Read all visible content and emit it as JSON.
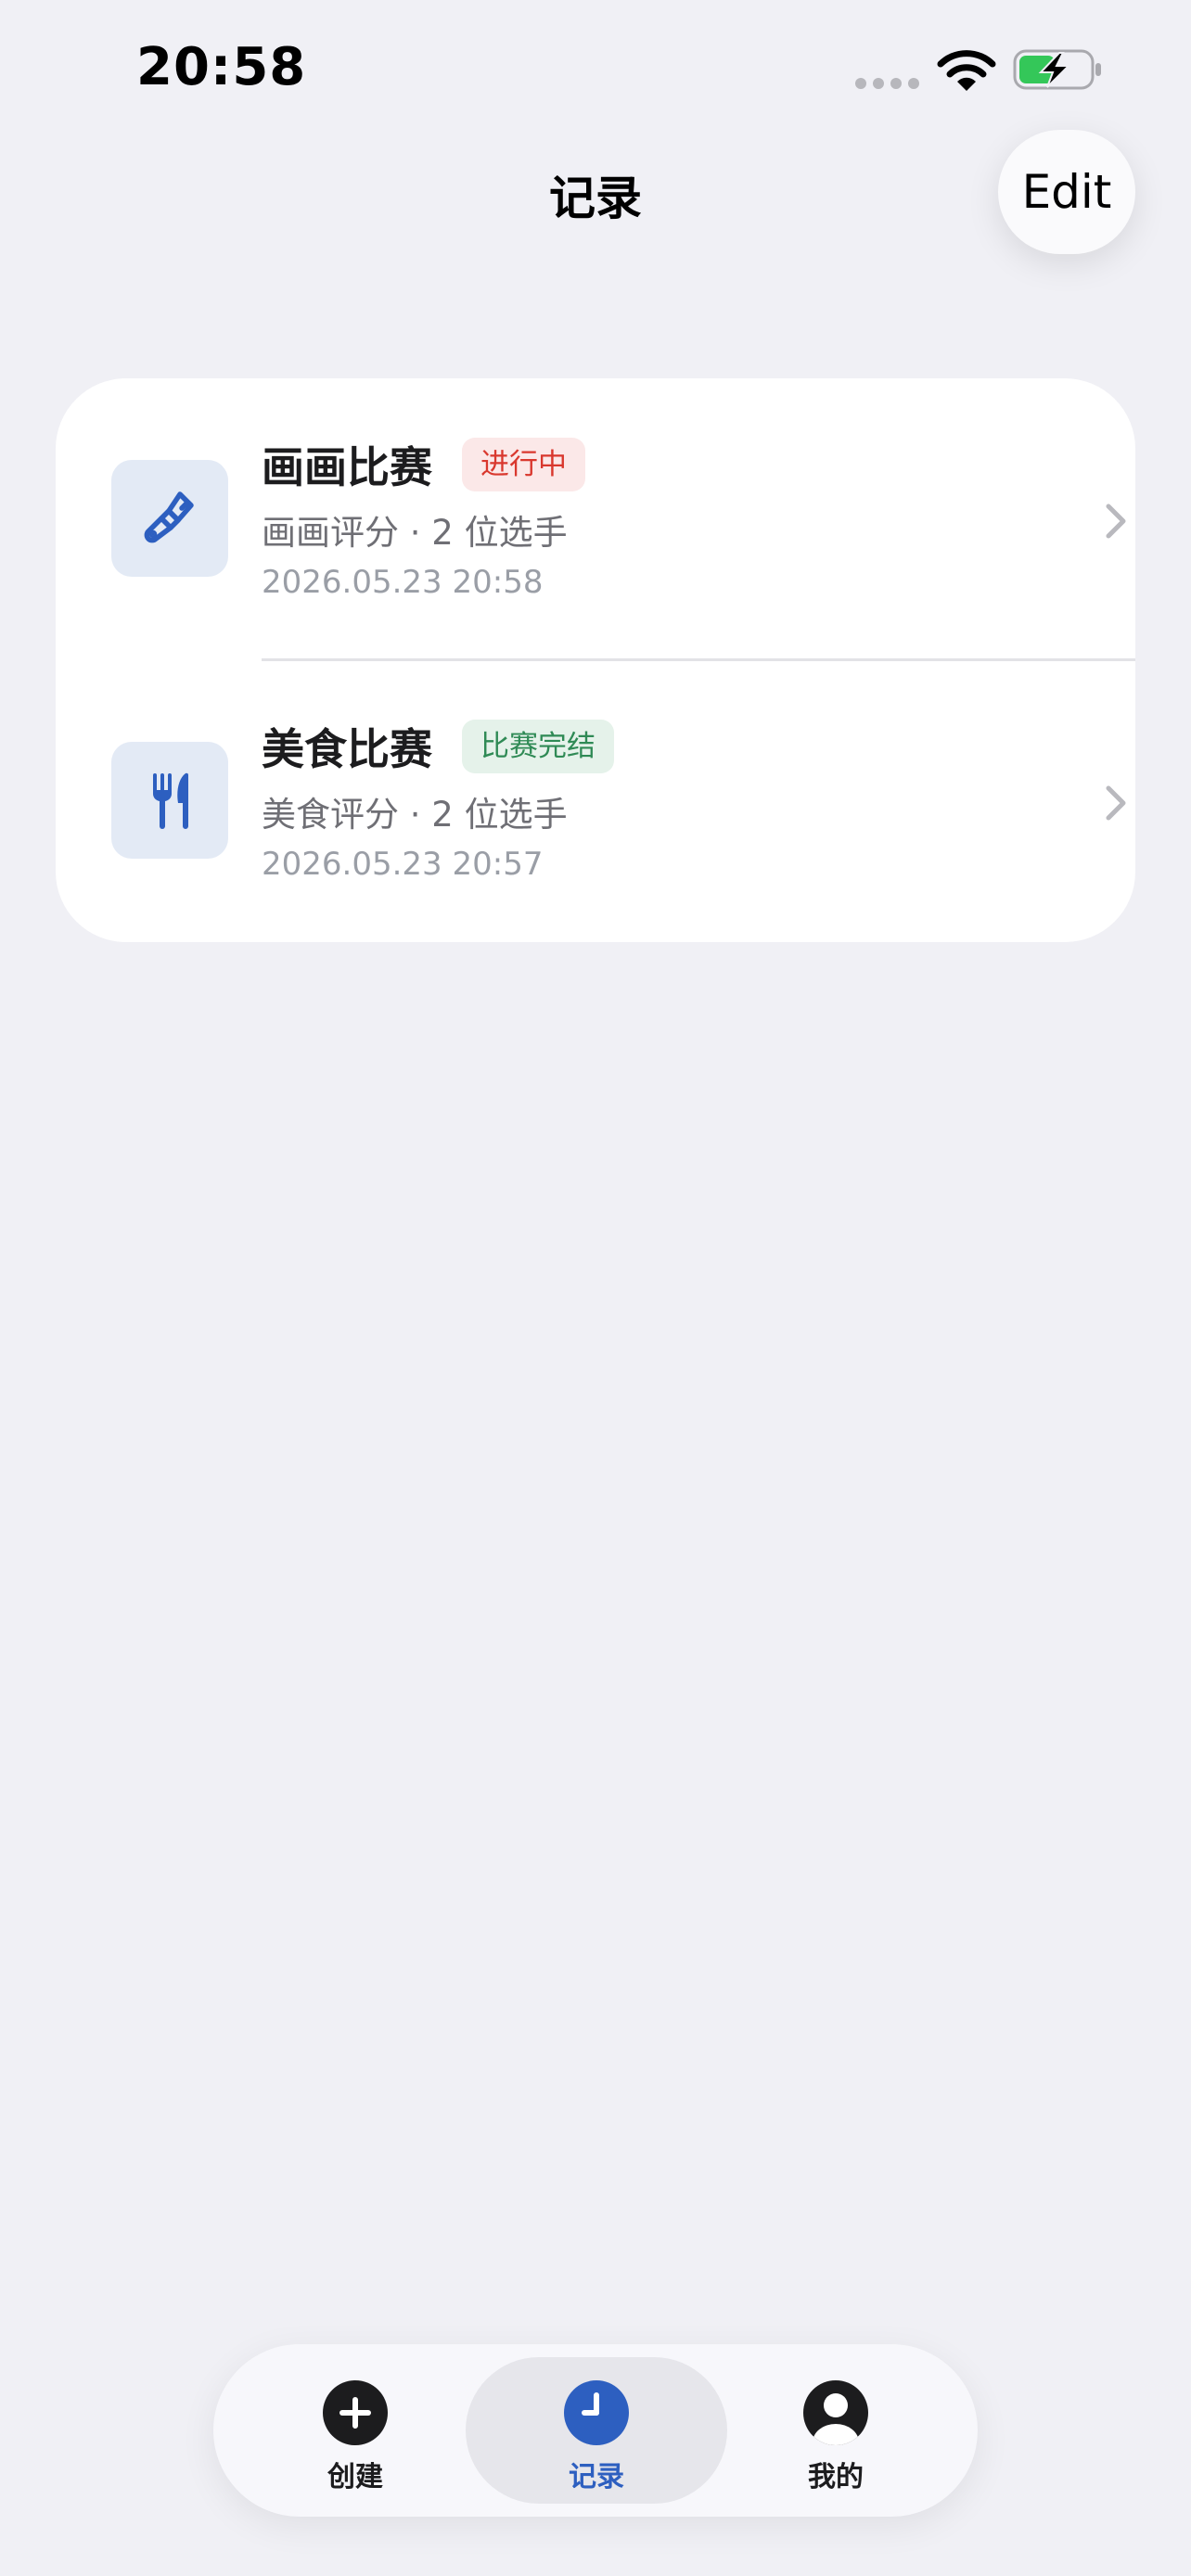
{
  "status_bar": {
    "time": "20:58"
  },
  "nav": {
    "title": "记录",
    "edit_label": "Edit"
  },
  "records": [
    {
      "title": "画画比赛",
      "icon": "paintbrush-icon",
      "status": "进行中",
      "subtitle": "画画评分 · 2 位选手",
      "time": "2026.05.23 20:58"
    },
    {
      "title": "美食比赛",
      "icon": "fork-knife-icon",
      "status": "比赛完结",
      "subtitle": "美食评分 · 2 位选手",
      "time": "2026.05.23 20:57"
    }
  ],
  "tabs": [
    {
      "label": "创建",
      "icon": "plus-circle-icon",
      "active": false
    },
    {
      "label": "记录",
      "icon": "clock-icon",
      "active": true
    },
    {
      "label": "我的",
      "icon": "person-circle-icon",
      "active": false
    }
  ],
  "colors": {
    "background": "#f0f0f5",
    "accent": "#2d5fc0",
    "status_running_text": "#d9382e",
    "status_running_bg": "#fbe8e8",
    "status_done_text": "#2f8a55",
    "status_done_bg": "#e5f2ea",
    "battery_green": "#34c759"
  }
}
